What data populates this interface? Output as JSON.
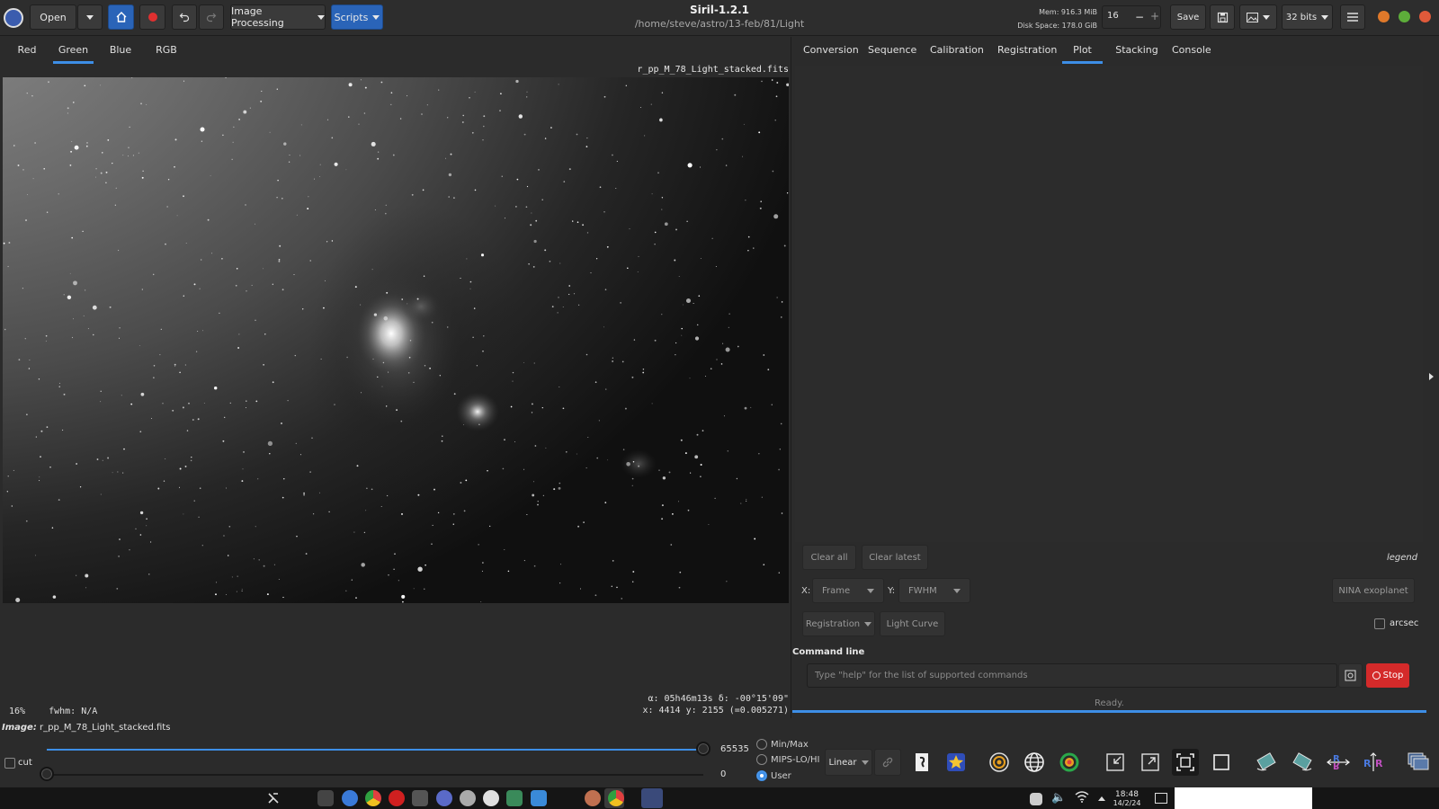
{
  "header": {
    "open_label": "Open",
    "image_processing_label": "Image Processing",
    "scripts_label": "Scripts",
    "title": "Siril-1.2.1",
    "path": "/home/steve/astro/13-feb/81/Light",
    "mem": "Mem: 916.3 MiB",
    "disk": "Disk Space: 178.0 GiB",
    "thread_count": "16",
    "save_label": "Save",
    "bits_label": "32 bits"
  },
  "left_tabs": [
    "Red",
    "Green",
    "Blue",
    "RGB"
  ],
  "left_active_tab": "Green",
  "image": {
    "filename": "r_pp_M_78_Light_stacked.fits",
    "zoom": "16%",
    "fwhm": "fwhm: N/A",
    "coords_line1": "α: 05h46m13s  δ: -00°15'09\"",
    "coords_line2": "x: 4414  y: 2155 (=0.005271)"
  },
  "right_tabs": [
    "Conversion",
    "Sequence",
    "Calibration",
    "Registration",
    "Plot",
    "Stacking",
    "Console"
  ],
  "right_active_tab": "Plot",
  "plot": {
    "clear_all": "Clear all",
    "clear_latest": "Clear latest",
    "legend": "legend",
    "x_label": "X:",
    "x_value": "Frame",
    "y_label": "Y:",
    "y_value": "FWHM",
    "nina_label": "NINA exoplanet",
    "registration_label": "Registration",
    "light_curve_label": "Light Curve",
    "arcsec_label": "arcsec"
  },
  "command": {
    "title": "Command line",
    "placeholder": "Type \"help\" for the list of supported commands",
    "stop_label": "Stop",
    "status": "Ready."
  },
  "bottom": {
    "image_label": "Image:",
    "image_name": "r_pp_M_78_Light_stacked.fits",
    "cut_label": "cut",
    "max_value": "65535",
    "min_value": "0",
    "radio_minmax": "Min/Max",
    "radio_mips": "MIPS-LO/HI",
    "radio_user": "User",
    "stretch_label": "Linear"
  },
  "taskbar": {
    "time": "18:48",
    "date": "14/2/24"
  },
  "colors": {
    "accent": "#3d8ee6",
    "primary_button": "#2a64b8",
    "stop_red": "#d42a2a"
  }
}
